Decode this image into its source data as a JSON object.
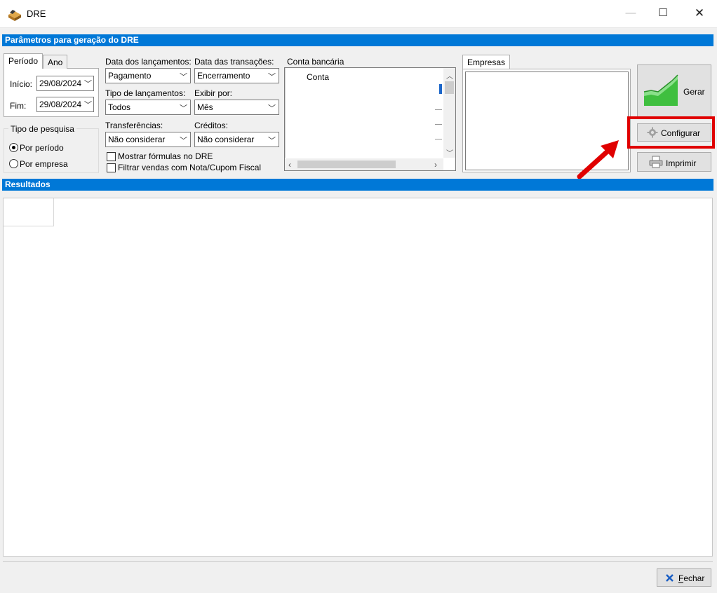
{
  "window": {
    "title": "DRE",
    "min_glyph": "—",
    "max_glyph": "☐",
    "close_glyph": "✕"
  },
  "params_header": "Parâmetros para geração do DRE",
  "tabs": {
    "periodo": "Período",
    "ano": "Ano"
  },
  "period": {
    "start_label": "Início:",
    "start_value": "29/08/2024",
    "end_label": "Fim:",
    "end_value": "29/08/2024"
  },
  "search_type": {
    "label": "Tipo de pesquisa",
    "option_period": "Por período",
    "option_company": "Por empresa",
    "selected": "Por período"
  },
  "fields": {
    "data_lancamentos_label": "Data dos lançamentos:",
    "data_lancamentos_value": "Pagamento",
    "data_transacoes_label": "Data das transações:",
    "data_transacoes_value": "Encerramento",
    "tipo_lancamentos_label": "Tipo de lançamentos:",
    "tipo_lancamentos_value": "Todos",
    "exibir_por_label": "Exibir por:",
    "exibir_por_value": "Mês",
    "transferencias_label": "Transferências:",
    "transferencias_value": "Não considerar",
    "creditos_label": "Créditos:",
    "creditos_value": "Não considerar"
  },
  "checkboxes": {
    "mostrar_formulas": "Mostrar fórmulas no DRE",
    "filtrar_vendas": "Filtrar vendas com Nota/Cupom Fiscal"
  },
  "conta_bancaria": {
    "label": "Conta bancária",
    "column_header": "Conta"
  },
  "empresas_tab": "Empresas",
  "buttons": {
    "gerar": "Gerar",
    "configurar": "Configurar",
    "imprimir": "Imprimir",
    "fechar": "Fechar"
  },
  "results_header": "Resultados",
  "colors": {
    "section_header": "#0078d7",
    "highlight_box": "#e00000",
    "arrow": "#e00000",
    "chart_icon_green": "#3fbf3f"
  },
  "icons": {
    "app": "package-icon",
    "gerar": "chart-growth-icon",
    "configurar": "gear-icon",
    "imprimir": "printer-icon",
    "fechar": "x-mark-icon"
  }
}
